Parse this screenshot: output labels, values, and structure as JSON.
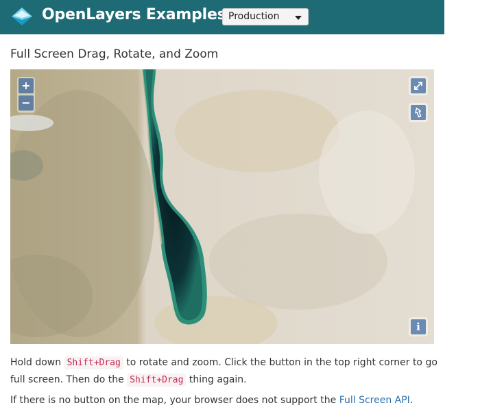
{
  "header": {
    "brand": "OpenLayers Examples",
    "version_select": "Production",
    "logo_icon": "openlayers-logo-icon"
  },
  "page": {
    "title": "Full Screen Drag, Rotate, and Zoom"
  },
  "map": {
    "controls": {
      "zoom_in": "+",
      "zoom_out": "−",
      "full_screen_icon": "expand-arrows-icon",
      "rotate_icon": "north-arrow-icon",
      "attribution": "i"
    }
  },
  "description": {
    "p1_a": "Hold down",
    "shortcut": "Shift+Drag",
    "p1_b": "to rotate and zoom. Click the button in the top right corner to go full screen. Then do the",
    "p1_c": "thing again.",
    "p2_a": "If there is no button on the map, your browser does not support the",
    "p2_link": "Full Screen API",
    "p2_end": "."
  },
  "colors": {
    "navbar": "#1f6b75",
    "control_bg": "#003c88",
    "link": "#2a6fb0",
    "code_text": "#c7254e"
  }
}
